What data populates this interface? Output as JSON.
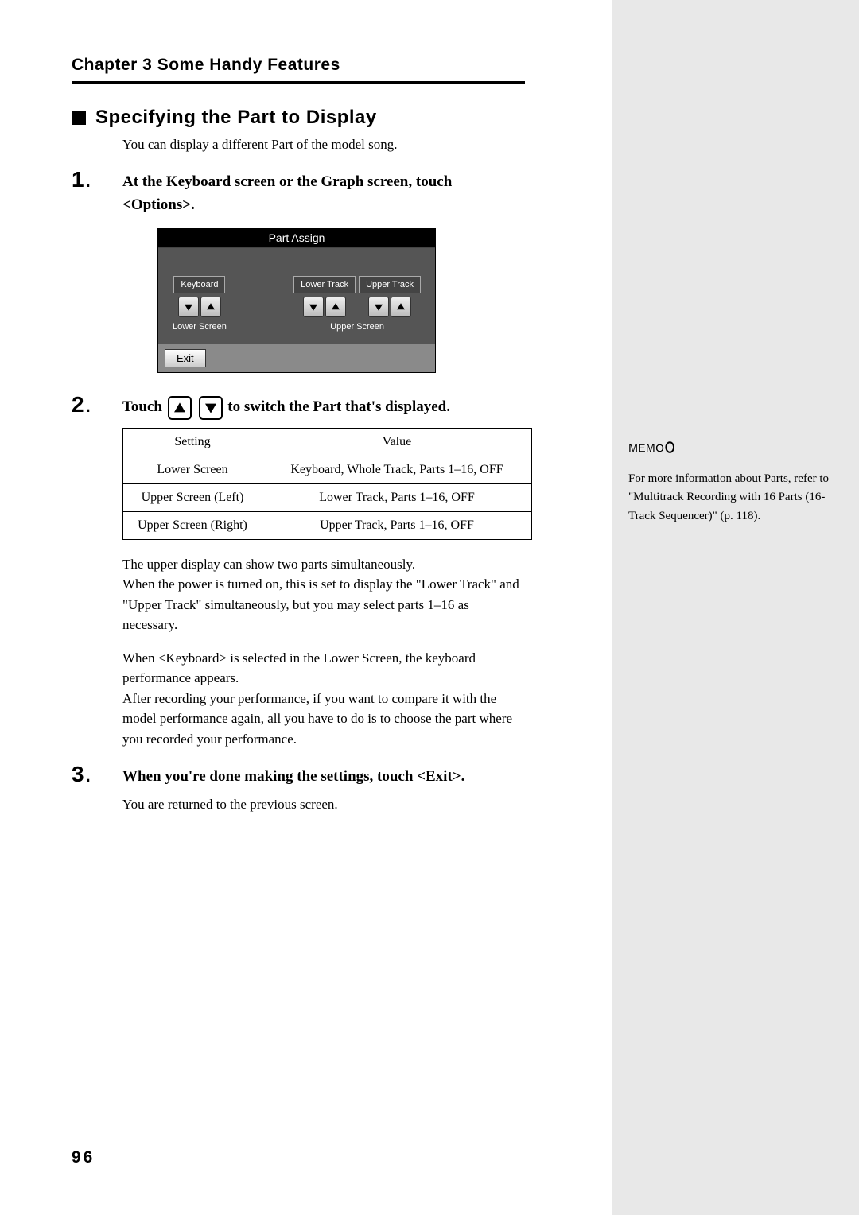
{
  "chapter_header": "Chapter 3 Some Handy Features",
  "section_title": "Specifying the Part to Display",
  "intro": "You can display a different Part of the model song.",
  "steps": {
    "s1": {
      "num": "1",
      "text_a": "At the Keyboard screen or the Graph screen, touch ",
      "text_b": "<Options>."
    },
    "s2": {
      "num": "2",
      "text_a": "Touch ",
      "text_b": " to switch the Part that's displayed."
    },
    "s3": {
      "num": "3",
      "text": "When you're done making the settings, touch <Exit>."
    }
  },
  "screenshot": {
    "title": "Part Assign",
    "keyboard_btn": "Keyboard",
    "lower_track_btn": "Lower Track",
    "upper_track_btn": "Upper Track",
    "lower_screen_label": "Lower Screen",
    "upper_screen_label": "Upper Screen",
    "exit_btn": "Exit"
  },
  "table": {
    "header_setting": "Setting",
    "header_value": "Value",
    "rows": [
      {
        "setting": "Lower Screen",
        "value": "Keyboard, Whole Track, Parts 1–16, OFF"
      },
      {
        "setting": "Upper Screen (Left)",
        "value": "Lower Track, Parts 1–16, OFF"
      },
      {
        "setting": "Upper Screen (Right)",
        "value": "Upper Track, Parts 1–16, OFF"
      }
    ]
  },
  "paras": {
    "p1": "The upper display can show two parts simultaneously.\nWhen the power is turned on, this is set to display the \"Lower Track\" and \"Upper Track\" simultaneously, but you may select parts 1–16 as necessary.",
    "p2": "When <Keyboard> is selected in the Lower Screen, the keyboard performance appears.\nAfter recording your performance, if you want to compare it with the model performance again, all you have to do is to choose the part where you recorded your performance.",
    "p3": "You are returned to the previous screen."
  },
  "memo": {
    "label": "MEMO",
    "text": "For more information about Parts, refer to \"Multitrack Recording with 16 Parts (16-Track Sequencer)\" (p. 118)."
  },
  "page_number": "96"
}
